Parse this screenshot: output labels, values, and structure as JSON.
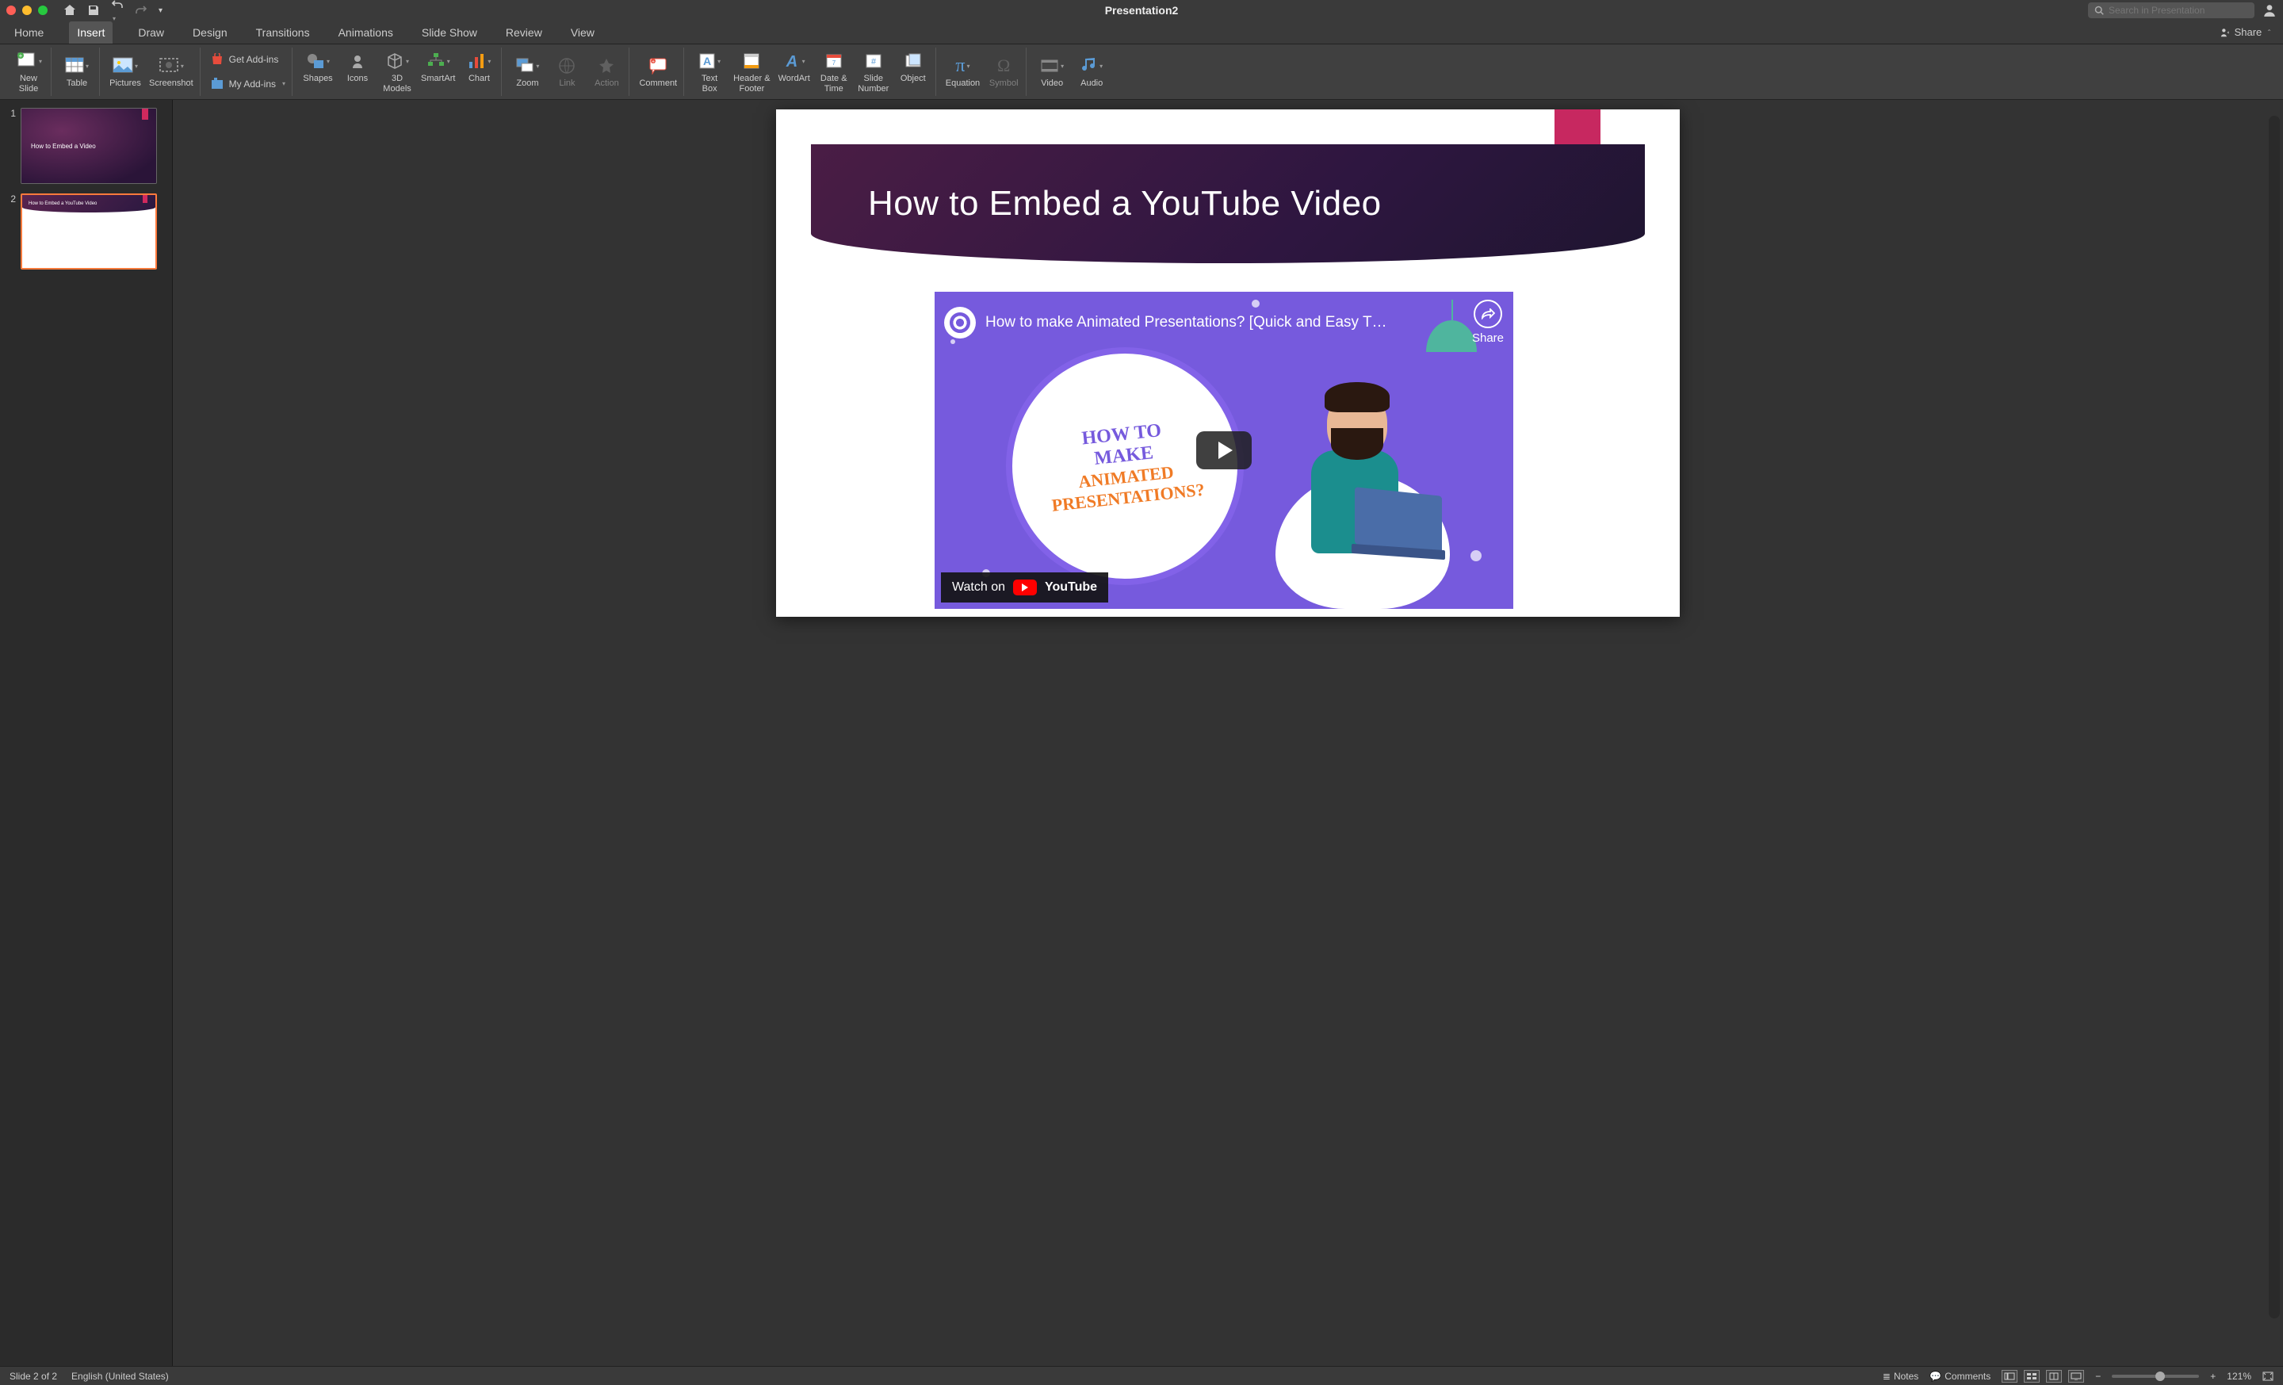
{
  "titlebar": {
    "title": "Presentation2",
    "search_placeholder": "Search in Presentation"
  },
  "tabs": [
    "Home",
    "Insert",
    "Draw",
    "Design",
    "Transitions",
    "Animations",
    "Slide Show",
    "Review",
    "View"
  ],
  "active_tab": "Insert",
  "share_label": "Share",
  "ribbon": {
    "new_slide": "New\nSlide",
    "table": "Table",
    "pictures": "Pictures",
    "screenshot": "Screenshot",
    "get_addins": "Get Add-ins",
    "my_addins": "My Add-ins",
    "shapes": "Shapes",
    "icons": "Icons",
    "models": "3D\nModels",
    "smartart": "SmartArt",
    "chart": "Chart",
    "zoom": "Zoom",
    "link": "Link",
    "action": "Action",
    "comment": "Comment",
    "text_box": "Text\nBox",
    "header_footer": "Header &\nFooter",
    "wordart": "WordArt",
    "date_time": "Date &\nTime",
    "slide_number": "Slide\nNumber",
    "object": "Object",
    "equation": "Equation",
    "symbol": "Symbol",
    "video": "Video",
    "audio": "Audio"
  },
  "thumbnails": {
    "slide1_text": "How to Embed a Video",
    "slide2_text": "How to Embed a YouTube Video"
  },
  "slide": {
    "title": "How to Embed a YouTube Video",
    "video": {
      "title": "How to make Animated Presentations? [Quick and Easy T…",
      "share_label": "Share",
      "circle_line1a": "HOW TO",
      "circle_line1b": "MAKE",
      "circle_line2a": "ANIMATED",
      "circle_line2b": "PRESENTATIONS?",
      "watch_label": "Watch on",
      "watch_brand": "YouTube"
    }
  },
  "statusbar": {
    "slide_info": "Slide 2 of 2",
    "language": "English (United States)",
    "notes": "Notes",
    "comments": "Comments",
    "zoom": "121%"
  }
}
